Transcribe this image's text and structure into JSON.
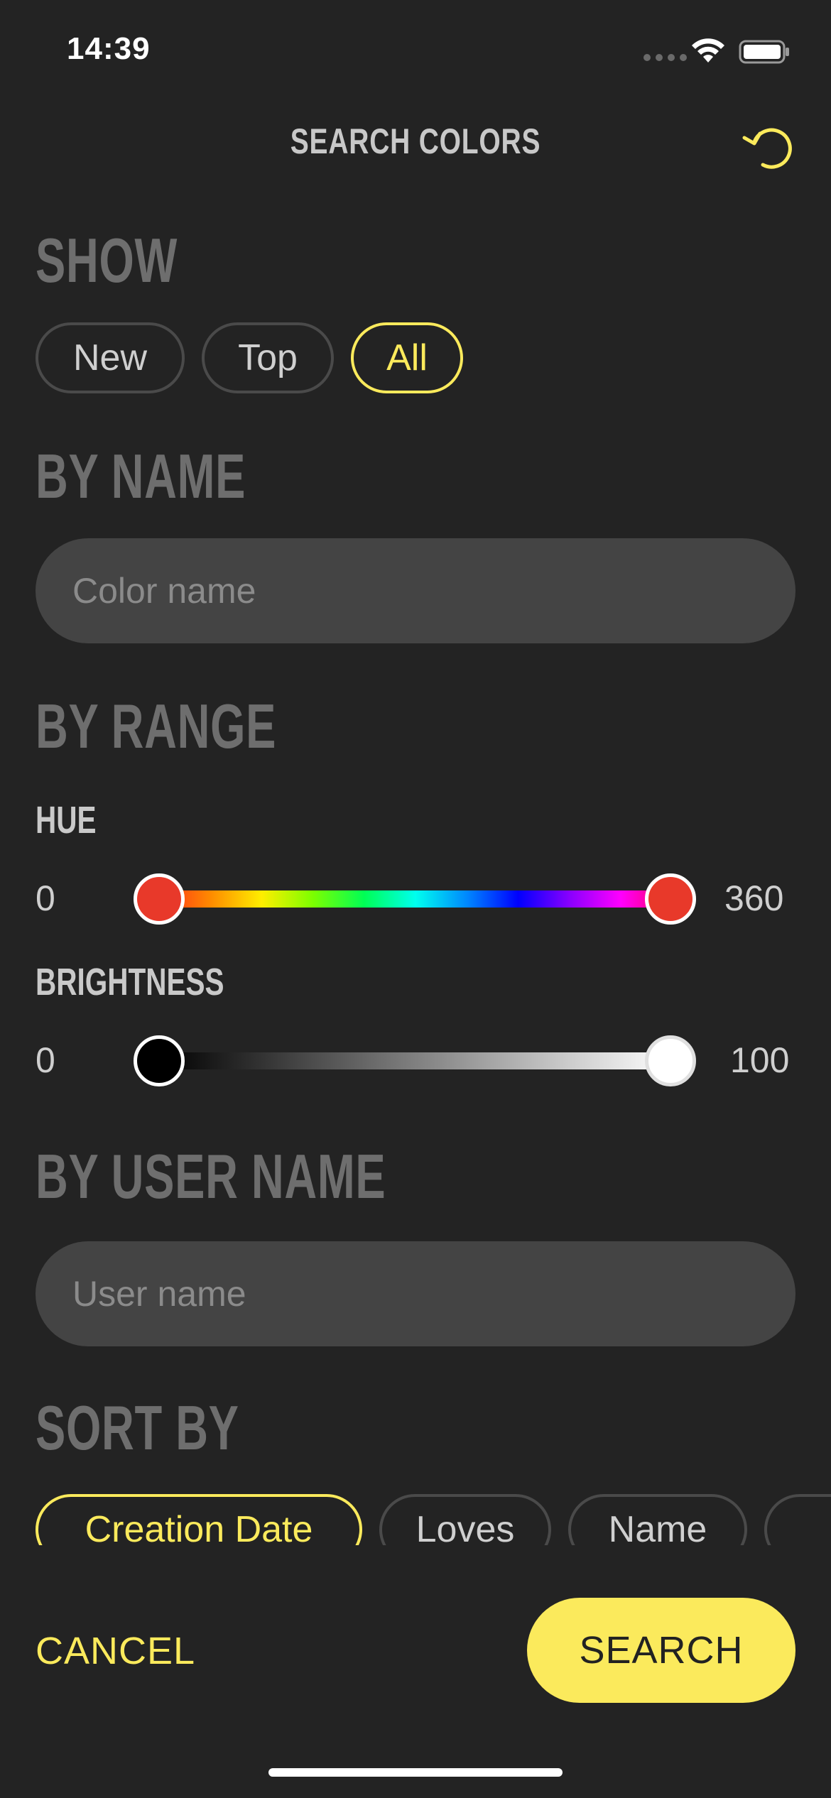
{
  "status_bar": {
    "time": "14:39"
  },
  "header": {
    "title": "SEARCH COLORS"
  },
  "show": {
    "heading": "SHOW",
    "options": [
      "New",
      "Top",
      "All"
    ],
    "selected": "All"
  },
  "by_name": {
    "heading": "BY NAME",
    "placeholder": "Color name",
    "value": ""
  },
  "by_range": {
    "heading": "BY RANGE",
    "hue": {
      "label": "HUE",
      "min_label": "0",
      "max_label": "360",
      "low": 0,
      "high": 360
    },
    "brightness": {
      "label": "BRIGHTNESS",
      "min_label": "0",
      "max_label": "100",
      "low": 0,
      "high": 100
    }
  },
  "by_user_name": {
    "heading": "BY USER NAME",
    "placeholder": "User name",
    "value": ""
  },
  "sort_by": {
    "heading": "SORT BY",
    "options": [
      "Creation Date",
      "Loves",
      "Name"
    ],
    "selected": "Creation Date"
  },
  "footer": {
    "cancel_label": "CANCEL",
    "search_label": "SEARCH"
  },
  "colors": {
    "background": "#232323",
    "accent": "#fbea5c",
    "field": "#444444",
    "hue_thumb": "#e8392a"
  }
}
